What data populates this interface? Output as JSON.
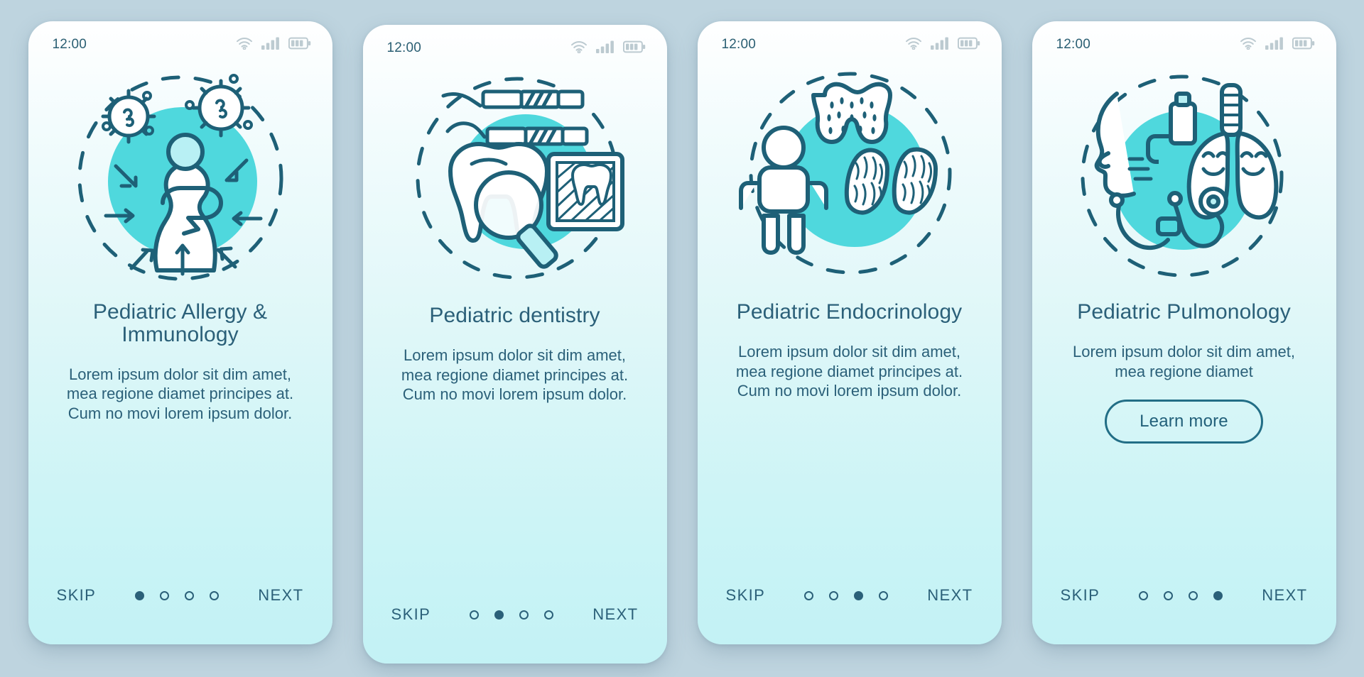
{
  "app": {
    "background_color": "#bed4df",
    "card_gradient_top": "#ffffff",
    "card_gradient_bottom": "#c3f2f5",
    "accent_color": "#4fd8dd",
    "ink_color": "#2b6079",
    "screens_count": 4
  },
  "status_bar": {
    "time": "12:00",
    "icons": [
      "wifi-icon",
      "signal-icon",
      "battery-icon"
    ]
  },
  "nav": {
    "skip_label": "SKIP",
    "next_label": "NEXT"
  },
  "screens": [
    {
      "id": "pediatric-allergy-immunology",
      "illustration": "allergy-virus-child-illustration",
      "title": "Pediatric Allergy & Immunology",
      "description": "Lorem ipsum dolor sit dim amet, mea regione diamet principes at. Cum no movi lorem ipsum dolor.",
      "active_dot": 0,
      "has_learn_more": false,
      "learn_more_label": ""
    },
    {
      "id": "pediatric-dentistry",
      "illustration": "dentistry-tooth-tools-xray-illustration",
      "title": "Pediatric dentistry",
      "description": "Lorem ipsum dolor sit dim amet, mea regione diamet principes at. Cum no movi lorem ipsum dolor.",
      "active_dot": 1,
      "has_learn_more": false,
      "learn_more_label": ""
    },
    {
      "id": "pediatric-endocrinology",
      "illustration": "endocrinology-thyroid-child-illustration",
      "title": "Pediatric Endocrinology",
      "description": "Lorem ipsum dolor sit dim amet, mea regione diamet principes at. Cum no movi lorem ipsum dolor.",
      "active_dot": 2,
      "has_learn_more": false,
      "learn_more_label": ""
    },
    {
      "id": "pediatric-pulmonology",
      "illustration": "pulmonology-lungs-inhaler-stethoscope-illustration",
      "title": "Pediatric Pulmonology",
      "description": "Lorem ipsum dolor sit dim amet, mea regione diamet",
      "active_dot": 3,
      "has_learn_more": true,
      "learn_more_label": "Learn more"
    }
  ]
}
